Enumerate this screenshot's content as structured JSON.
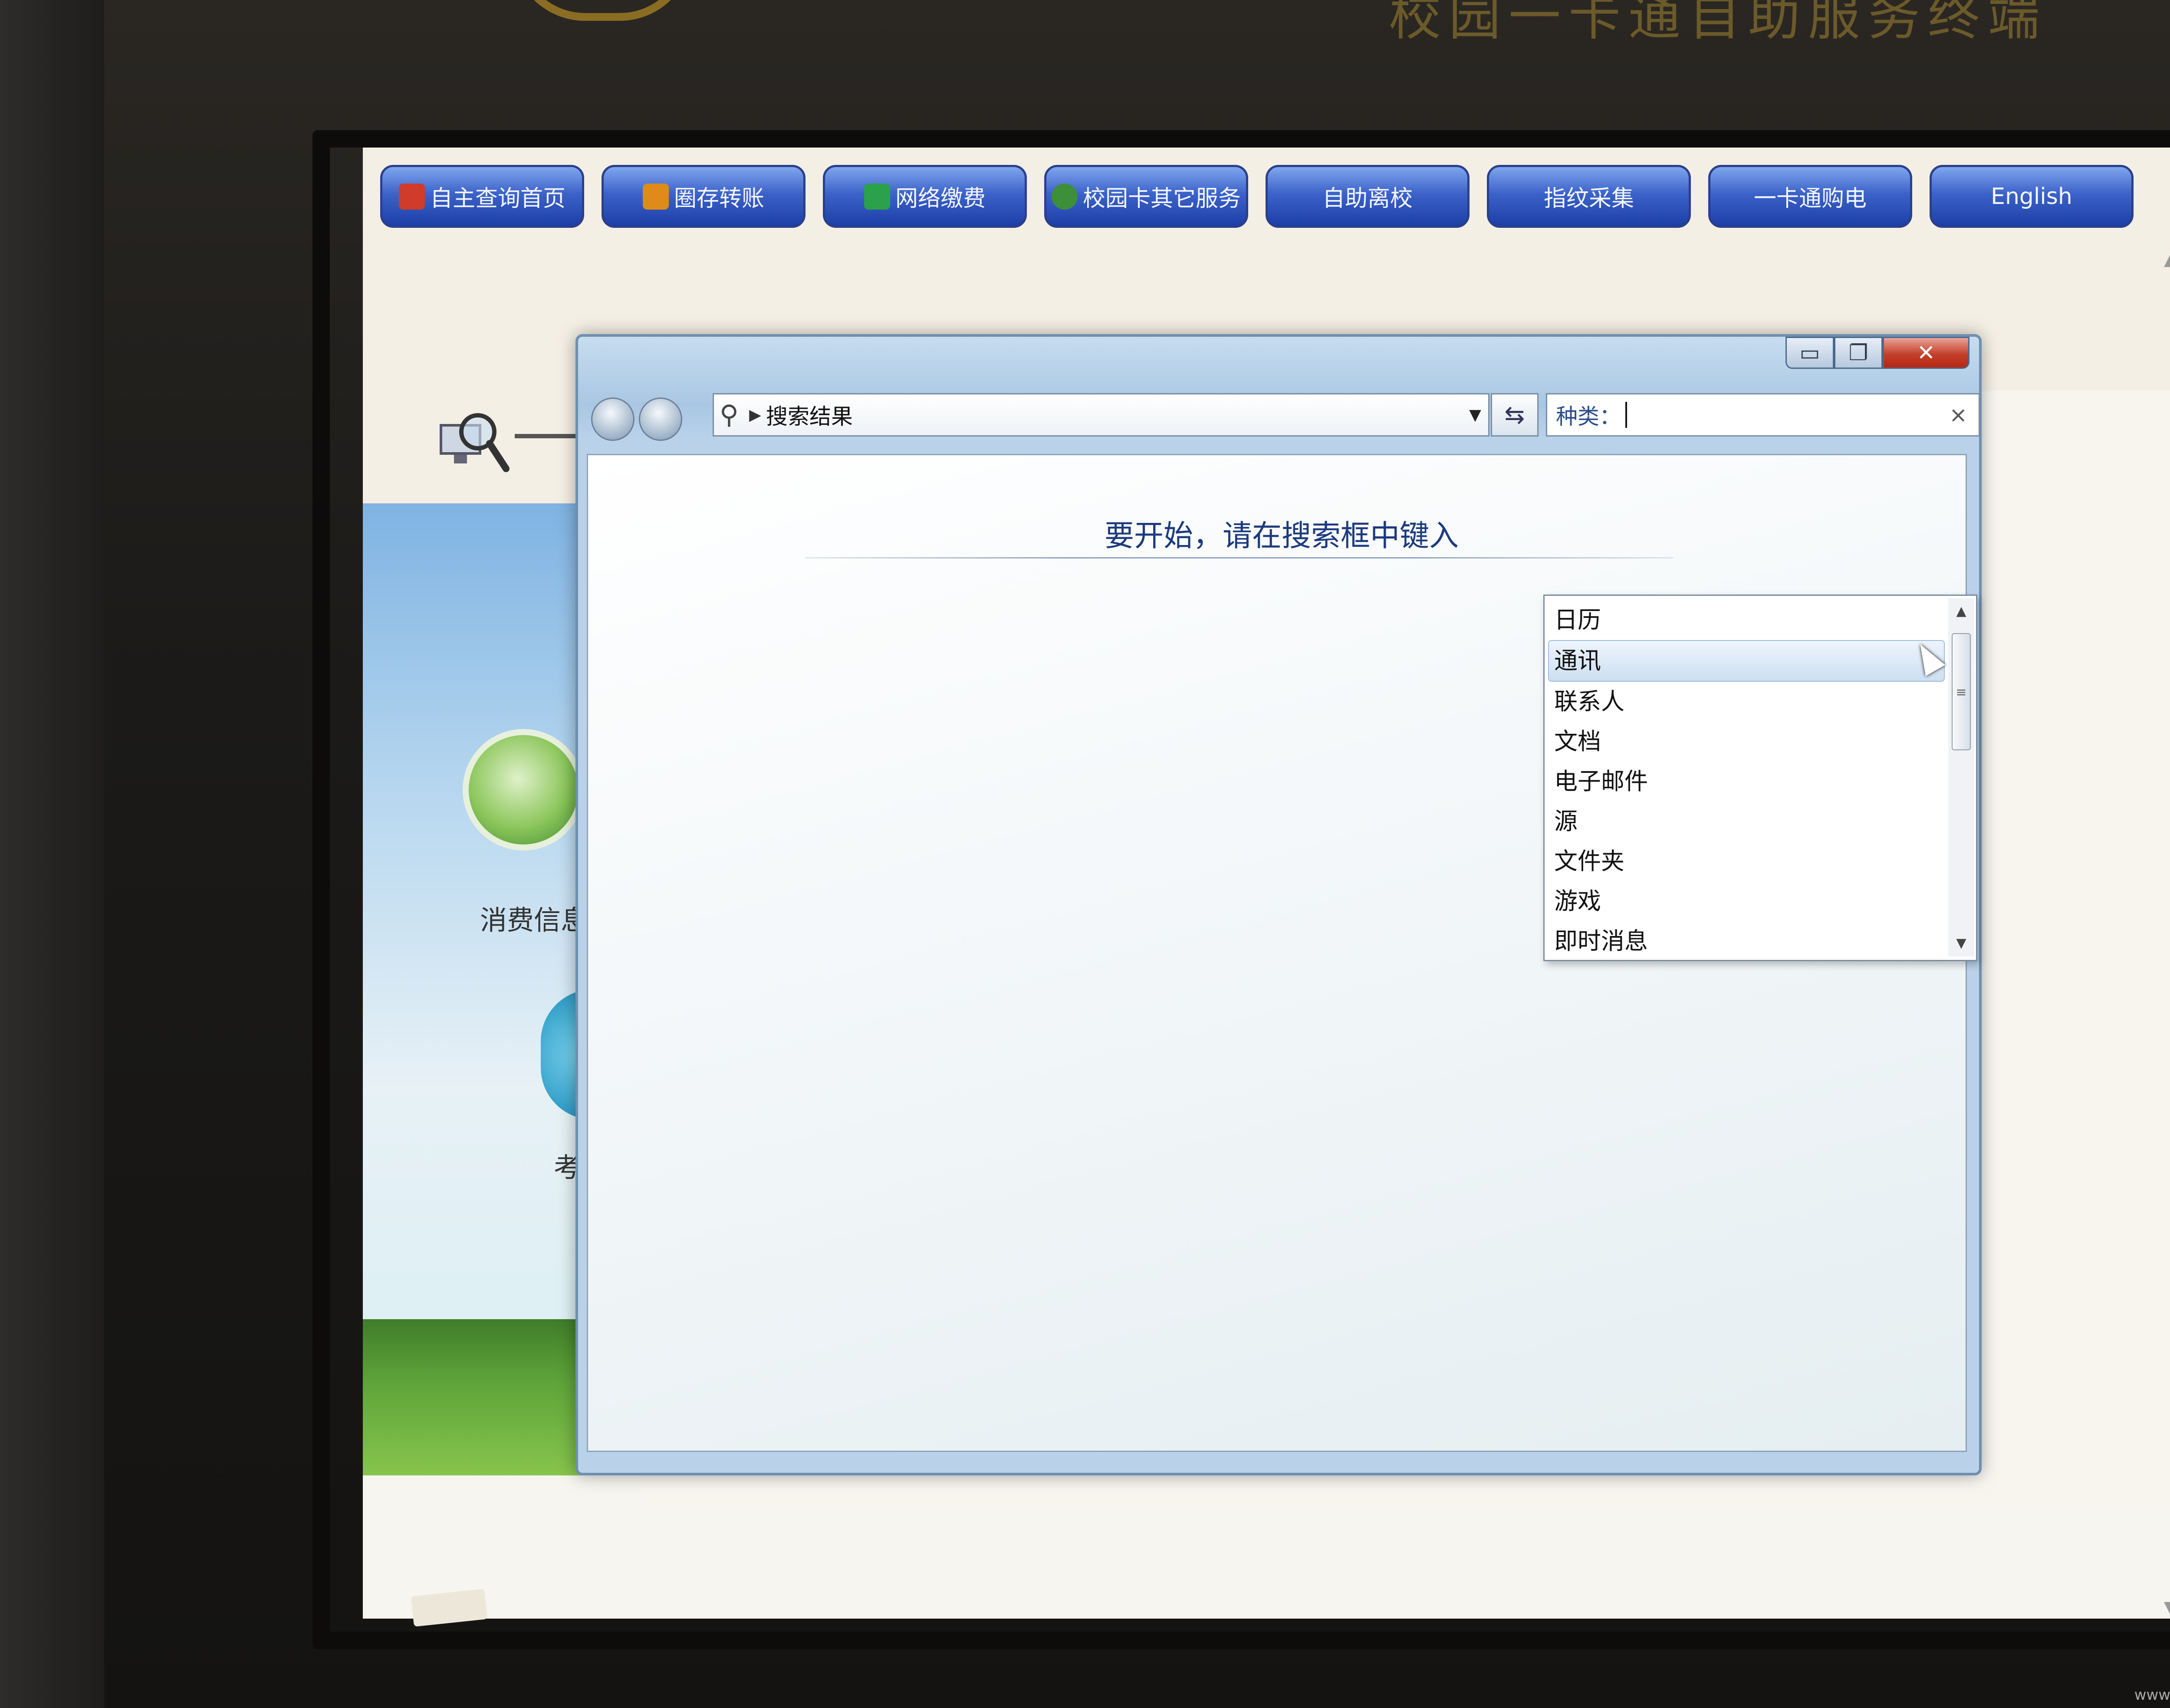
{
  "kiosk": {
    "title": "校园一卡通自助服务终端"
  },
  "topnav": [
    {
      "label": "自主查询首页",
      "icon": "home-icon",
      "color": "#d03b2a"
    },
    {
      "label": "圈存转账",
      "icon": "coins-icon",
      "color": "#e08a1a"
    },
    {
      "label": "网络缴费",
      "icon": "network-icon",
      "color": "#2aa14a"
    },
    {
      "label": "校园卡其它服务",
      "icon": "globe-icon",
      "color": "#3d8f3a"
    },
    {
      "label": "自助离校",
      "icon": "",
      "color": ""
    },
    {
      "label": "指纹采集",
      "icon": "",
      "color": ""
    },
    {
      "label": "一卡通购电",
      "icon": "",
      "color": ""
    },
    {
      "label": "English",
      "icon": "",
      "color": ""
    }
  ],
  "background": {
    "consume_label": "消费信息",
    "exam_label": "考"
  },
  "explorer": {
    "address_crumb": "搜索结果",
    "search_prefix": "种类：",
    "search_value": "",
    "clear_glyph": "×",
    "hint": "要开始，请在搜索框中键入",
    "caption_min": "▭",
    "caption_max": "❐",
    "caption_close": "✕"
  },
  "dropdown": {
    "items": [
      "日历",
      "通讯",
      "联系人",
      "文档",
      "电子邮件",
      "源",
      "文件夹",
      "游戏",
      "即时消息"
    ],
    "selected_index": 1
  },
  "watermark": "www.wooyun.org"
}
